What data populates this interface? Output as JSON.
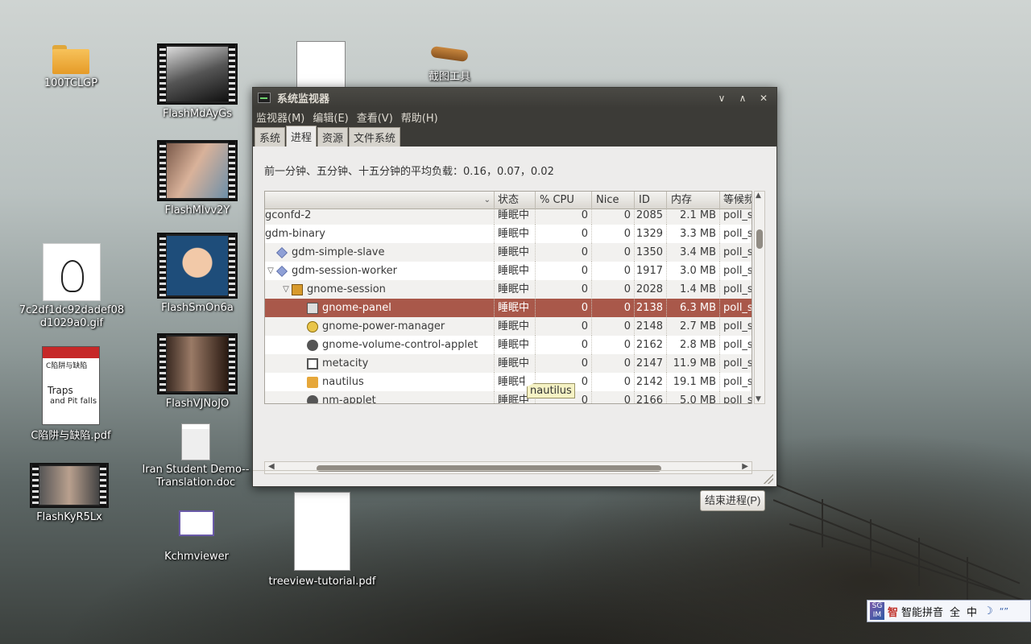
{
  "desktop": {
    "icons": [
      {
        "label": "100TCLGP"
      },
      {
        "label": "FlashMdAyGs"
      },
      {
        "label": "截图工具"
      },
      {
        "label": "FlashMIvv2Y"
      },
      {
        "label": "7c2df1dc92dadef08"
      },
      {
        "label": "d1029a0.gif"
      },
      {
        "label": "FlashSmOn6a"
      },
      {
        "label": "C陷阱与缺陷.pdf"
      },
      {
        "label": "FlashVJNoJO"
      },
      {
        "label": "Iran Student Demo--"
      },
      {
        "label": "Translation.doc"
      },
      {
        "label": "FlashKyR5Lx"
      },
      {
        "label": "Kchmviewer"
      },
      {
        "label": "treeview-tutorial.pdf"
      }
    ],
    "book_cover": {
      "title": "C陷阱与缺陷",
      "subtitle1": "Traps",
      "subtitle2": "and Pit falls",
      "accent": "#c62828"
    }
  },
  "window": {
    "title": "系统监视器",
    "controls": {
      "minimize": "∨",
      "maximize": "∧",
      "close": "✕"
    },
    "menu": [
      "监视器(M)",
      "编辑(E)",
      "查看(V)",
      "帮助(H)"
    ],
    "tabs": [
      "系统",
      "进程",
      "资源",
      "文件系统"
    ],
    "active_tab": "进程",
    "load_average": "前一分钟、五分钟、十五分钟的平均负载：0.16，0.07，0.02",
    "columns": [
      "",
      "状态",
      "% CPU",
      "Nice",
      "ID",
      "内存",
      "等候频"
    ],
    "rows": [
      {
        "name": "gconfd-2",
        "state": "睡眠中",
        "cpu": "0",
        "nice": "0",
        "id": "2085",
        "mem": "2.1 MB",
        "wait": "poll_s",
        "depth": 0,
        "expander": "",
        "icon": ""
      },
      {
        "name": "gdm-binary",
        "state": "睡眠中",
        "cpu": "0",
        "nice": "0",
        "id": "1329",
        "mem": "3.3 MB",
        "wait": "poll_s",
        "depth": 0,
        "expander": "",
        "icon": ""
      },
      {
        "name": "gdm-simple-slave",
        "state": "睡眠中",
        "cpu": "0",
        "nice": "0",
        "id": "1350",
        "mem": "3.4 MB",
        "wait": "poll_s",
        "depth": 0,
        "expander": "",
        "icon": "diamond"
      },
      {
        "name": "gdm-session-worker",
        "state": "睡眠中",
        "cpu": "0",
        "nice": "0",
        "id": "1917",
        "mem": "3.0 MB",
        "wait": "poll_s",
        "depth": 0,
        "expander": "▽",
        "icon": "diamond"
      },
      {
        "name": "gnome-session",
        "state": "睡眠中",
        "cpu": "0",
        "nice": "0",
        "id": "2028",
        "mem": "1.4 MB",
        "wait": "poll_s",
        "depth": 1,
        "expander": "▽",
        "icon": "session"
      },
      {
        "name": "gnome-panel",
        "state": "睡眠中",
        "cpu": "0",
        "nice": "0",
        "id": "2138",
        "mem": "6.3 MB",
        "wait": "poll_s",
        "depth": 2,
        "expander": "",
        "icon": "panel",
        "selected": true
      },
      {
        "name": "gnome-power-manager",
        "state": "睡眠中",
        "cpu": "0",
        "nice": "0",
        "id": "2148",
        "mem": "2.7 MB",
        "wait": "poll_s",
        "depth": 2,
        "expander": "",
        "icon": "power"
      },
      {
        "name": "gnome-volume-control-applet",
        "state": "睡眠中",
        "cpu": "0",
        "nice": "0",
        "id": "2162",
        "mem": "2.8 MB",
        "wait": "poll_s",
        "depth": 2,
        "expander": "",
        "icon": "volume"
      },
      {
        "name": "metacity",
        "state": "睡眠中",
        "cpu": "0",
        "nice": "0",
        "id": "2147",
        "mem": "11.9 MB",
        "wait": "poll_s",
        "depth": 2,
        "expander": "",
        "icon": "window-ico"
      },
      {
        "name": "nautilus",
        "state": "睡眠中",
        "cpu": "0",
        "nice": "0",
        "id": "2142",
        "mem": "19.1 MB",
        "wait": "poll_s",
        "depth": 2,
        "expander": "",
        "icon": "folder"
      },
      {
        "name": "nm-applet",
        "state": "睡眠中",
        "cpu": "0",
        "nice": "0",
        "id": "2166",
        "mem": "5.0 MB",
        "wait": "poll_s",
        "depth": 2,
        "expander": "",
        "icon": "volume"
      }
    ],
    "end_process_button": "结束进程(P)",
    "tooltip": "nautilus",
    "selection_color": "#a9584a"
  },
  "ime": {
    "logo": "SG IM",
    "zhi": "智",
    "name": "智能拼音",
    "full": "全",
    "zh": "中",
    "moon": "☽",
    "quote": "“”"
  }
}
